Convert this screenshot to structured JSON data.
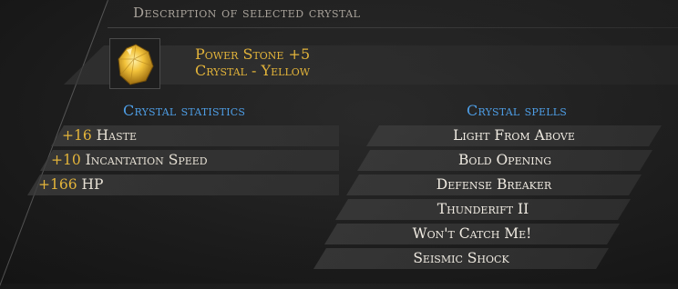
{
  "header": {
    "title": "Description of selected crystal"
  },
  "item": {
    "name": "Power Stone +5",
    "type": "Crystal - Yellow",
    "icon": "yellow-crystal-icon",
    "colors": {
      "gold": "#e3b43a",
      "section_blue": "#4e9ee6"
    }
  },
  "statistics": {
    "title": "Crystal statistics",
    "items": [
      {
        "value": "+16",
        "name": "Haste"
      },
      {
        "value": "+10",
        "name": "Incantation Speed"
      },
      {
        "value": "+166",
        "name": "HP"
      }
    ]
  },
  "spells": {
    "title": "Crystal spells",
    "items": [
      "Light From Above",
      "Bold Opening",
      "Defense Breaker",
      "Thunderift II",
      "Won't Catch Me!",
      "Seismic Shock"
    ]
  }
}
